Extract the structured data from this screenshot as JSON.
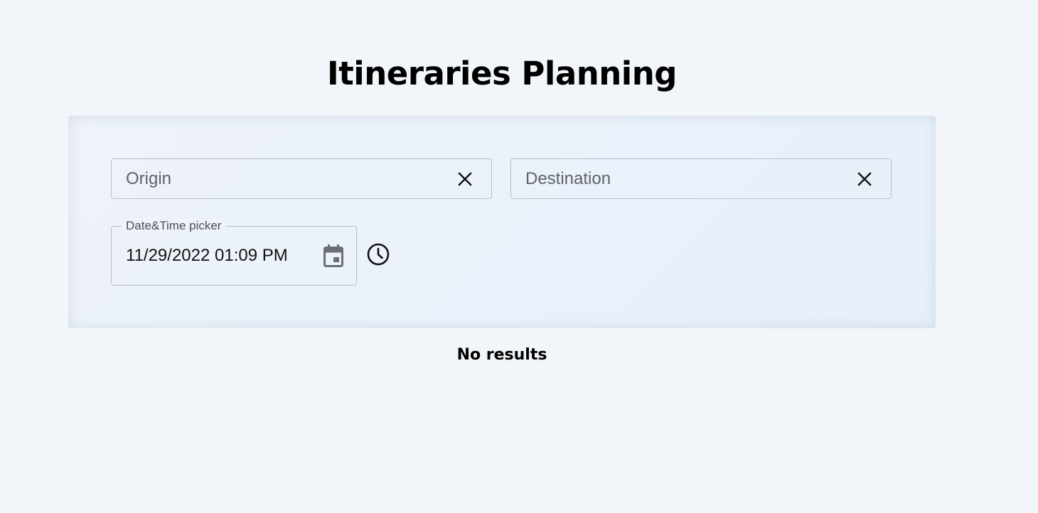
{
  "page": {
    "title": "Itineraries Planning",
    "status": "No results"
  },
  "search": {
    "origin": {
      "placeholder": "Origin",
      "value": ""
    },
    "destination": {
      "placeholder": "Destination",
      "value": ""
    },
    "datetime": {
      "label": "Date&Time picker",
      "value": "11/29/2022 01:09 PM"
    }
  },
  "icons": {
    "clear_origin": "close-icon",
    "clear_destination": "close-icon",
    "calendar": "calendar-icon",
    "clock": "clock-icon"
  },
  "colors": {
    "background": "#f2f6fa",
    "panel": "#eaf1fa",
    "field_border": "#b7bfc8",
    "placeholder": "#5f6368",
    "icon_muted": "#6b6f74"
  }
}
